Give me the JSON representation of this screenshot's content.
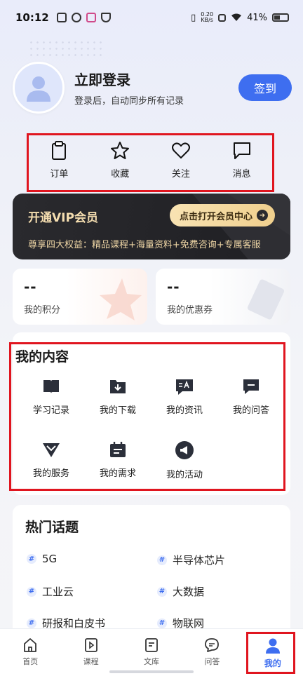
{
  "status_bar": {
    "time": "10:12",
    "netspeed_value": "0.20",
    "netspeed_unit": "KB/s",
    "battery": "41%"
  },
  "profile": {
    "title": "立即登录",
    "subtitle": "登录后，自动同步所有记录",
    "signin_label": "签到"
  },
  "quick_actions": [
    {
      "label": "订单",
      "icon": "clipboard-icon"
    },
    {
      "label": "收藏",
      "icon": "star-icon"
    },
    {
      "label": "关注",
      "icon": "heart-icon"
    },
    {
      "label": "消息",
      "icon": "message-icon"
    }
  ],
  "vip": {
    "title": "开通VIP会员",
    "button_label": "点击打开会员中心",
    "description": "尊享四大权益：精品课程+海量资料+免费咨询+专属客服"
  },
  "stats": [
    {
      "value": "--",
      "label": "我的积分"
    },
    {
      "value": "--",
      "label": "我的优惠券"
    }
  ],
  "my_content": {
    "title": "我的内容",
    "items": [
      {
        "label": "学习记录",
        "icon": "book-icon"
      },
      {
        "label": "我的下载",
        "icon": "download-folder-icon"
      },
      {
        "label": "我的资讯",
        "icon": "news-icon"
      },
      {
        "label": "我的问答",
        "icon": "qa-icon"
      },
      {
        "label": "我的服务",
        "icon": "service-icon"
      },
      {
        "label": "我的需求",
        "icon": "calendar-icon"
      },
      {
        "label": "我的活动",
        "icon": "megaphone-icon"
      }
    ]
  },
  "hot_topics": {
    "title": "热门话题",
    "hash_symbol": "#",
    "items": [
      "5G",
      "半导体芯片",
      "工业云",
      "大数据",
      "研报和白皮书",
      "物联网"
    ]
  },
  "tabbar": {
    "items": [
      {
        "label": "首页",
        "icon": "home-icon"
      },
      {
        "label": "课程",
        "icon": "course-icon"
      },
      {
        "label": "文库",
        "icon": "library-icon"
      },
      {
        "label": "问答",
        "icon": "chat-icon"
      },
      {
        "label": "我的",
        "icon": "user-icon"
      }
    ],
    "active_index": 4
  },
  "colors": {
    "accent": "#3e6ef0",
    "highlight_border": "#e0151f",
    "vip_gold": "#f5deb0"
  }
}
